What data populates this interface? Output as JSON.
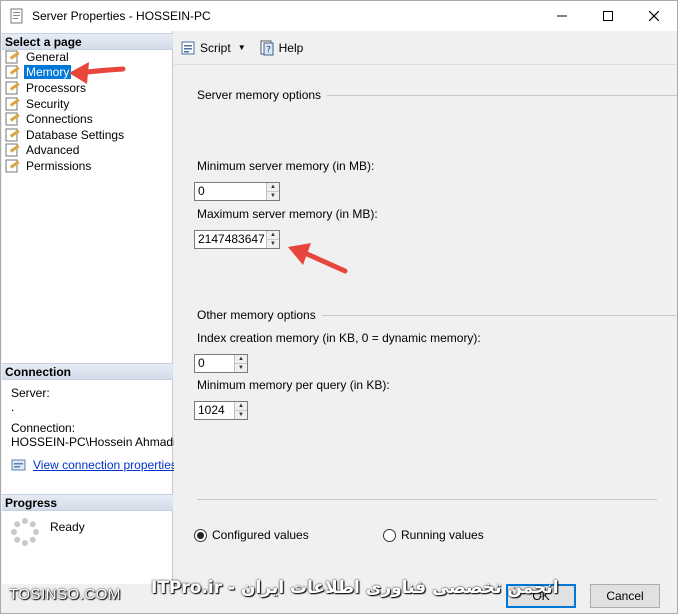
{
  "window": {
    "title": "Server Properties - HOSSEIN-PC",
    "controls": {
      "minimize": "—",
      "maximize": "☐",
      "close": "✕"
    }
  },
  "left": {
    "select_page_header": "Select a page",
    "pages": [
      {
        "label": "General",
        "selected": false
      },
      {
        "label": "Memory",
        "selected": true
      },
      {
        "label": "Processors",
        "selected": false
      },
      {
        "label": "Security",
        "selected": false
      },
      {
        "label": "Connections",
        "selected": false
      },
      {
        "label": "Database Settings",
        "selected": false
      },
      {
        "label": "Advanced",
        "selected": false
      },
      {
        "label": "Permissions",
        "selected": false
      }
    ],
    "connection_header": "Connection",
    "server_label": "Server:",
    "server_value": ".",
    "connection_label": "Connection:",
    "connection_value": "HOSSEIN-PC\\Hossein Ahmadi",
    "view_connection_link": "View connection properties",
    "progress_header": "Progress",
    "progress_status": "Ready"
  },
  "toolbar": {
    "script_label": "Script",
    "help_label": "Help"
  },
  "main": {
    "server_memory_options": "Server memory options",
    "min_memory_label": "Minimum server memory (in MB):",
    "min_memory_value": "0",
    "max_memory_label": "Maximum server memory (in MB):",
    "max_memory_value": "2147483647",
    "other_memory_options": "Other memory options",
    "index_creation_label": "Index creation memory (in KB, 0 = dynamic memory):",
    "index_creation_value": "0",
    "min_query_label": "Minimum memory per query (in KB):",
    "min_query_value": "1024",
    "configured_values": "Configured values",
    "running_values": "Running values",
    "configured_selected": true
  },
  "buttons": {
    "ok": "OK",
    "cancel": "Cancel"
  },
  "watermarks": {
    "left": "TOSINSO.COM",
    "right": "انجمن تخصصی فناوری اطلاعات ایران - ITPro.ir"
  },
  "colors": {
    "selection": "#0078d7",
    "link": "#0033cc",
    "annotation_arrow": "#e8453c"
  }
}
